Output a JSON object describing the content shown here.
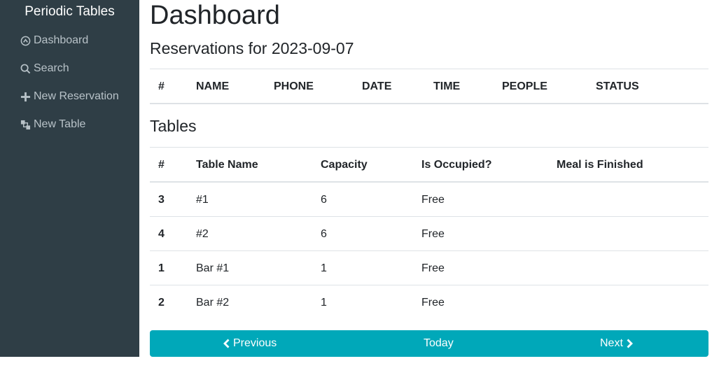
{
  "sidebar": {
    "brand": "Periodic Tables",
    "items": [
      {
        "label": "Dashboard",
        "icon": "dashboard-icon"
      },
      {
        "label": "Search",
        "icon": "search-icon"
      },
      {
        "label": "New Reservation",
        "icon": "plus-icon"
      },
      {
        "label": "New Table",
        "icon": "layers-icon"
      }
    ]
  },
  "main": {
    "title": "Dashboard",
    "subtitle": "Reservations for 2023-09-07",
    "reservations": {
      "headers": [
        "#",
        "NAME",
        "PHONE",
        "DATE",
        "TIME",
        "PEOPLE",
        "STATUS"
      ]
    },
    "tables_title": "Tables",
    "tables": {
      "headers": [
        "#",
        "Table Name",
        "Capacity",
        "Is Occupied?",
        "Meal is Finished"
      ],
      "rows": [
        {
          "id": "3",
          "name": "#1",
          "capacity": "6",
          "status": "Free"
        },
        {
          "id": "4",
          "name": "#2",
          "capacity": "6",
          "status": "Free"
        },
        {
          "id": "1",
          "name": "Bar #1",
          "capacity": "1",
          "status": "Free"
        },
        {
          "id": "2",
          "name": "Bar #2",
          "capacity": "1",
          "status": "Free"
        }
      ]
    }
  },
  "pager": {
    "previous": "Previous",
    "today": "Today",
    "next": "Next"
  },
  "colors": {
    "sidebar_bg": "#2f3e46",
    "accent": "#00a8b9"
  }
}
